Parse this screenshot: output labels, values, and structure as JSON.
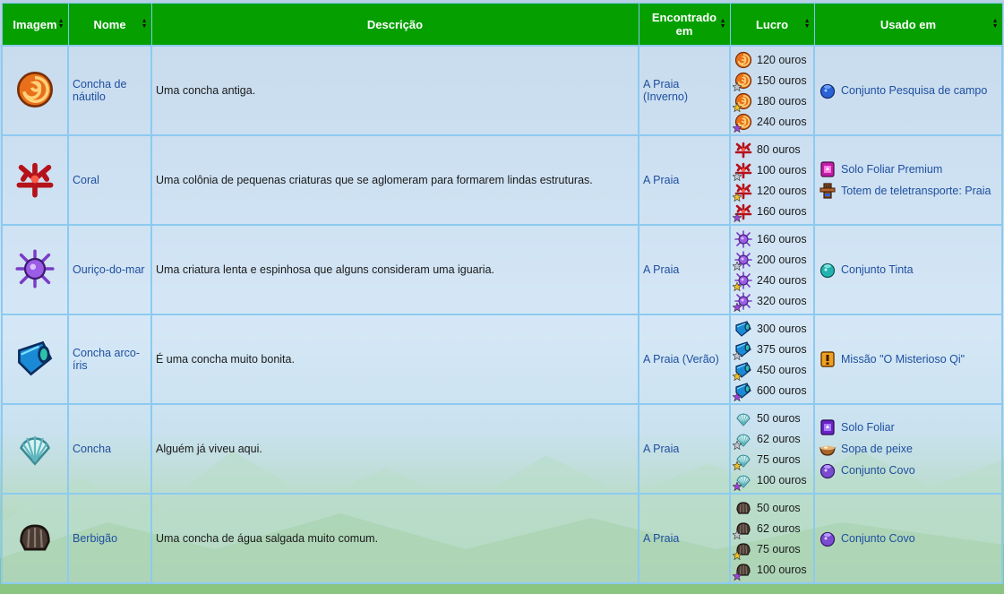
{
  "headers": {
    "image": "Imagem",
    "name": "Nome",
    "description": "Descrição",
    "found": "Encontrado em",
    "profit": "Lucro",
    "used": "Usado em"
  },
  "rows": [
    {
      "item_icon": "nautilus-shell-icon",
      "name": "Concha de náutilo",
      "description": "Uma concha antiga.",
      "found": "A Praia",
      "found_note": "(Inverno)",
      "prices": [
        "120 ouros",
        "150 ouros",
        "180 ouros",
        "240 ouros"
      ],
      "used": [
        {
          "icon": "bundle-blue-icon",
          "label": "Conjunto Pesquisa de campo"
        }
      ]
    },
    {
      "item_icon": "coral-icon",
      "name": "Coral",
      "description": "Uma colônia de pequenas criaturas que se aglomeram para formarem lindas estruturas.",
      "found": "A Praia",
      "found_note": "",
      "prices": [
        "80 ouros",
        "100 ouros",
        "120 ouros",
        "160 ouros"
      ],
      "used": [
        {
          "icon": "deluxe-fertilizer-icon",
          "label": "Solo Foliar Premium"
        },
        {
          "icon": "warp-totem-icon",
          "label": "Totem de teletransporte: Praia"
        }
      ]
    },
    {
      "item_icon": "sea-urchin-icon",
      "name": "Ouriço-do-mar",
      "description": "Uma criatura lenta e espinhosa que alguns consideram uma iguaria.",
      "found": "A Praia",
      "found_note": "",
      "prices": [
        "160 ouros",
        "200 ouros",
        "240 ouros",
        "320 ouros"
      ],
      "used": [
        {
          "icon": "bundle-teal-icon",
          "label": "Conjunto Tinta"
        }
      ]
    },
    {
      "item_icon": "rainbow-shell-icon",
      "name": "Concha arco-íris",
      "description": "É uma concha muito bonita.",
      "found": "A Praia",
      "found_note": "(Verão)",
      "prices": [
        "300 ouros",
        "375 ouros",
        "450 ouros",
        "600 ouros"
      ],
      "used": [
        {
          "icon": "quest-icon",
          "label": "Missão \"O Misterioso Qi\""
        }
      ]
    },
    {
      "item_icon": "clam-icon",
      "name": "Concha",
      "description": "Alguém já viveu aqui.",
      "found": "A Praia",
      "found_note": "",
      "prices": [
        "50 ouros",
        "62 ouros",
        "75 ouros",
        "100 ouros"
      ],
      "used": [
        {
          "icon": "fertilizer-icon",
          "label": "Solo Foliar"
        },
        {
          "icon": "soup-icon",
          "label": "Sopa de peixe"
        },
        {
          "icon": "bundle-purple-icon",
          "label": "Conjunto Covo"
        }
      ]
    },
    {
      "item_icon": "cockle-icon",
      "name": "Berbigão",
      "description": "Uma concha de água salgada muito comum.",
      "found": "A Praia",
      "found_note": "",
      "prices": [
        "50 ouros",
        "62 ouros",
        "75 ouros",
        "100 ouros"
      ],
      "used": [
        {
          "icon": "bundle-purple-icon",
          "label": "Conjunto Covo"
        }
      ]
    }
  ],
  "colors": {
    "header_bg": "#05a000",
    "link": "#1f4fa0",
    "border": "#8ccaf0"
  }
}
